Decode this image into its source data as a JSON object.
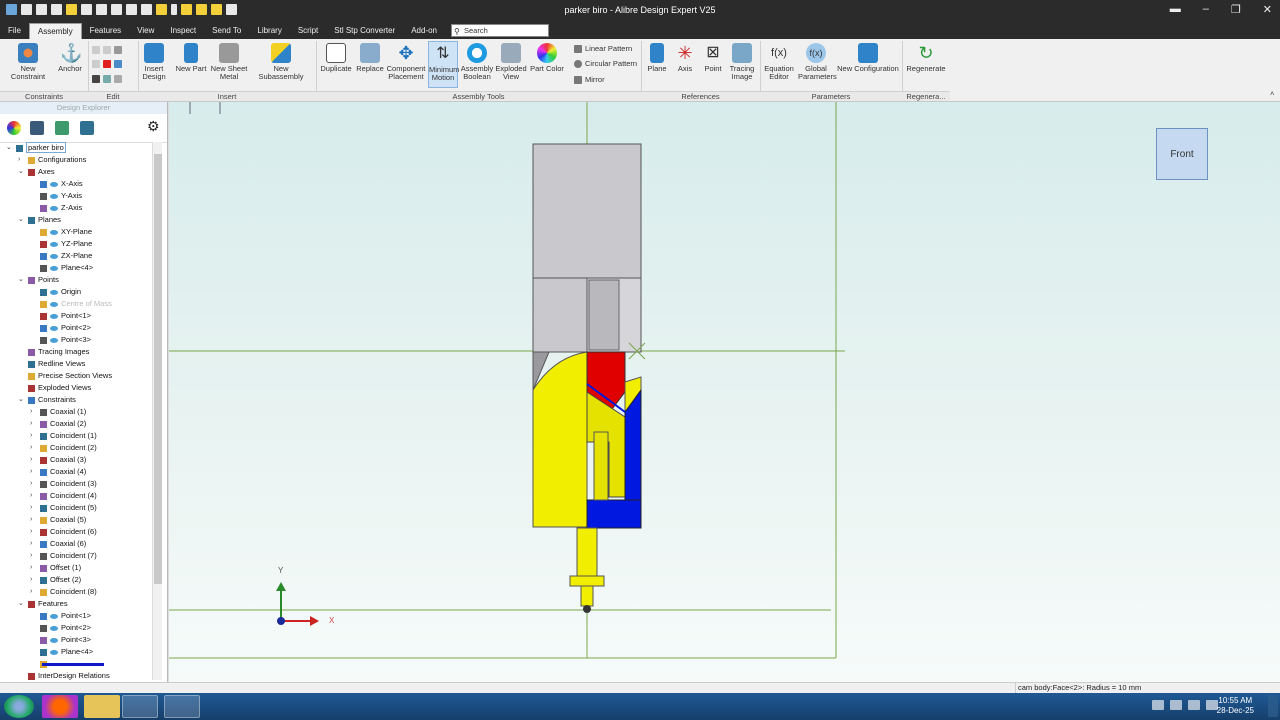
{
  "window": {
    "title": "parker biro - Alibre Design Expert V25"
  },
  "tabs": [
    "File",
    "Assembly",
    "Features",
    "View",
    "Inspect",
    "Send To",
    "Library",
    "Script",
    "Stl Stp Converter",
    "Add-on"
  ],
  "active_tab": "Assembly",
  "search": {
    "placeholder": "Search"
  },
  "ribbon": {
    "new_constraint": "New Constraint",
    "anchor": "Anchor",
    "insert_design": [
      "Insert",
      "Design"
    ],
    "new_part": "New Part",
    "new_sheet_metal": [
      "New Sheet",
      "Metal"
    ],
    "new_subassembly": "New Subassembly",
    "duplicate": "Duplicate",
    "replace": "Replace",
    "component_placement": [
      "Component",
      "Placement"
    ],
    "minimum_motion": [
      "Minimum",
      "Motion"
    ],
    "assembly_boolean": [
      "Assembly",
      "Boolean"
    ],
    "exploded_view": [
      "Exploded",
      "View"
    ],
    "part_color": "Part Color",
    "linear_pattern": "Linear Pattern",
    "circular_pattern": "Circular Pattern",
    "mirror": "Mirror",
    "plane": "Plane",
    "axis": "Axis",
    "point": "Point",
    "tracing_image": [
      "Tracing",
      "Image"
    ],
    "equation_editor": [
      "Equation",
      "Editor"
    ],
    "global_parameters": [
      "Global",
      "Parameters"
    ],
    "new_configuration": "New Configuration",
    "regenerate": "Regenerate"
  },
  "groups": [
    "Constraints",
    "Edit",
    "Insert",
    "Assembly Tools",
    "References",
    "Parameters",
    "Regenera..."
  ],
  "explorer": {
    "header": "Design Explorer",
    "tree": [
      {
        "label": "parker biro",
        "level": 0,
        "toggle": "v"
      },
      {
        "label": "Configurations",
        "level": 1,
        "toggle": ">"
      },
      {
        "label": "Axes",
        "level": 1,
        "toggle": "v"
      },
      {
        "label": "X-Axis",
        "level": 2
      },
      {
        "label": "Y-Axis",
        "level": 2
      },
      {
        "label": "Z-Axis",
        "level": 2
      },
      {
        "label": "Planes",
        "level": 1,
        "toggle": "v"
      },
      {
        "label": "XY-Plane",
        "level": 2
      },
      {
        "label": "YZ-Plane",
        "level": 2
      },
      {
        "label": "ZX-Plane",
        "level": 2
      },
      {
        "label": "Plane<4>",
        "level": 2
      },
      {
        "label": "Points",
        "level": 1,
        "toggle": "v"
      },
      {
        "label": "Origin",
        "level": 2
      },
      {
        "label": "Centre of Mass",
        "level": 2,
        "disabled": true
      },
      {
        "label": "Point<1>",
        "level": 2
      },
      {
        "label": "Point<2>",
        "level": 2
      },
      {
        "label": "Point<3>",
        "level": 2
      },
      {
        "label": "Tracing Images",
        "level": 1
      },
      {
        "label": "Redline Views",
        "level": 1
      },
      {
        "label": "Precise Section Views",
        "level": 1
      },
      {
        "label": "Exploded Views",
        "level": 1
      },
      {
        "label": "Constraints",
        "level": 1,
        "toggle": "v"
      },
      {
        "label": "Coaxial (1)",
        "level": 2,
        "toggle": ">"
      },
      {
        "label": "Coaxial (2)",
        "level": 2,
        "toggle": ">"
      },
      {
        "label": "Coincident (1)",
        "level": 2,
        "toggle": ">"
      },
      {
        "label": "Coincident (2)",
        "level": 2,
        "toggle": ">"
      },
      {
        "label": "Coaxial (3)",
        "level": 2,
        "toggle": ">"
      },
      {
        "label": "Coaxial (4)",
        "level": 2,
        "toggle": ">"
      },
      {
        "label": "Coincident (3)",
        "level": 2,
        "toggle": ">"
      },
      {
        "label": "Coincident (4)",
        "level": 2,
        "toggle": ">"
      },
      {
        "label": "Coincident (5)",
        "level": 2,
        "toggle": ">"
      },
      {
        "label": "Coaxial (5)",
        "level": 2,
        "toggle": ">"
      },
      {
        "label": "Coincident (6)",
        "level": 2,
        "toggle": ">"
      },
      {
        "label": "Coaxial (6)",
        "level": 2,
        "toggle": ">"
      },
      {
        "label": "Coincident (7)",
        "level": 2,
        "toggle": ">"
      },
      {
        "label": "Offset (1)",
        "level": 2,
        "toggle": ">"
      },
      {
        "label": "Offset (2)",
        "level": 2,
        "toggle": ">"
      },
      {
        "label": "Coincident (8)",
        "level": 2,
        "toggle": ">"
      },
      {
        "label": "Features",
        "level": 1,
        "toggle": "v"
      },
      {
        "label": "Point<1>",
        "level": 2
      },
      {
        "label": "Point<2>",
        "level": 2
      },
      {
        "label": "Point<3>",
        "level": 2
      },
      {
        "label": "Plane<4>",
        "level": 2
      },
      {
        "label": "",
        "level": 2
      },
      {
        "label": "InterDesign Relations",
        "level": 1
      }
    ]
  },
  "viewport": {
    "view_label": "Front",
    "axis_x": "X",
    "axis_y": "Y"
  },
  "status": {
    "message": "cam body:Face<2>: Radius = 10 mm"
  },
  "taskbar": {
    "time": "10:55 AM",
    "date": "28-Dec-25"
  },
  "colors": {
    "accent": "#1e73be",
    "yellow": "#f2ee00",
    "red": "#e00000",
    "blue": "#0018e0",
    "gray": "#c8c8cc"
  }
}
